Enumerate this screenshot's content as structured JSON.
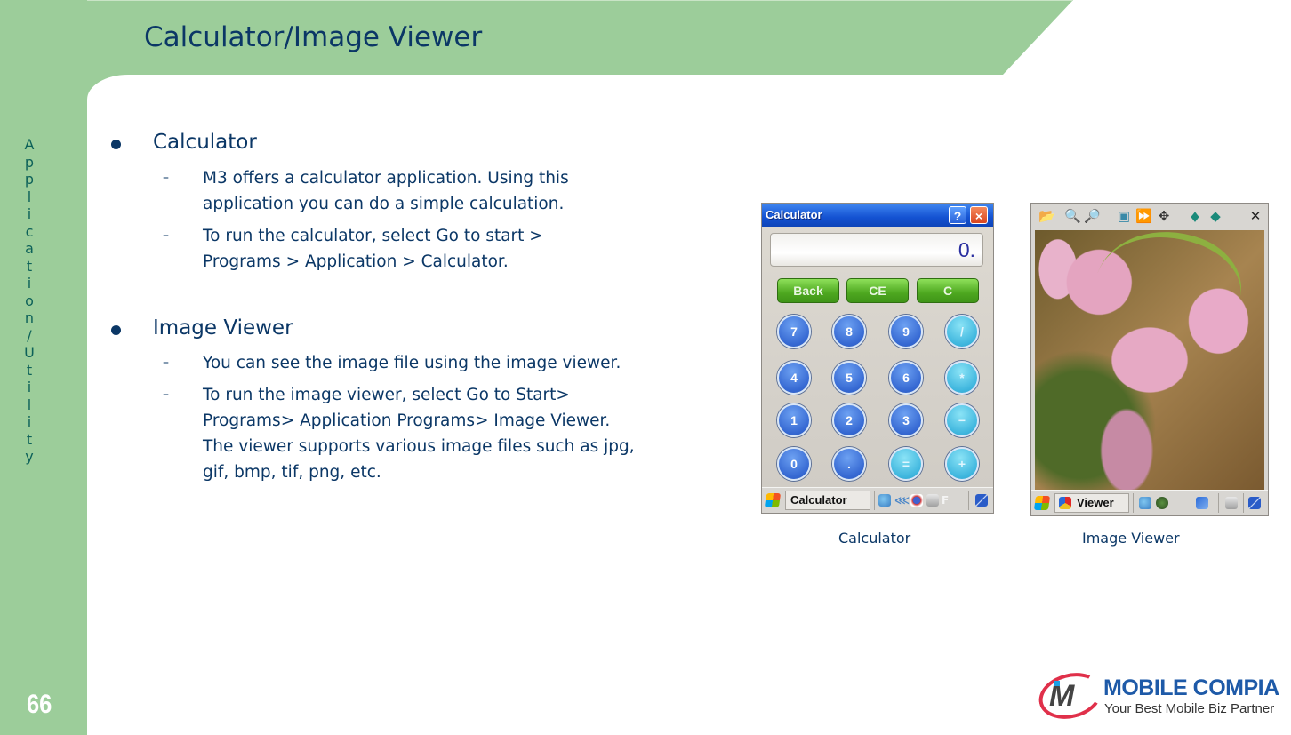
{
  "page": {
    "title": "Calculator/Image Viewer",
    "side_label": "Application/Utility",
    "page_number": "66"
  },
  "sections": [
    {
      "heading": "Calculator",
      "items": [
        [
          "M3 offers a calculator application. Using this",
          "application you can do a simple calculation."
        ],
        [
          "To run the calculator, select Go to start >",
          "Programs > Application > Calculator."
        ]
      ]
    },
    {
      "heading": "Image Viewer",
      "items": [
        [
          "You can see the image file using the image viewer."
        ],
        [
          "To run the image viewer, select Go to Start>",
          "Programs> Application Programs> Image Viewer.",
          "The viewer supports various image files such as jpg,",
          "gif, bmp, tif, png, etc."
        ]
      ]
    }
  ],
  "calculator_screenshot": {
    "window_title": "Calculator",
    "help_button": "?",
    "close_button": "×",
    "display_value": "0.",
    "function_buttons": [
      "Back",
      "CE",
      "C"
    ],
    "keypad": [
      [
        "7",
        "8",
        "9",
        "/"
      ],
      [
        "4",
        "5",
        "6",
        "*"
      ],
      [
        "1",
        "2",
        "3",
        "−"
      ],
      [
        "0",
        ".",
        "=",
        "+"
      ]
    ],
    "taskbar_label": "Calculator",
    "tray_letter": "F",
    "colors": {
      "titlebar": "#1452d2",
      "function_button": "#4ea820",
      "number_key": "#3568d2",
      "operator_key": "#3fb6de"
    }
  },
  "viewer_screenshot": {
    "toolbar_icons": [
      "open-folder-icon",
      "zoom-in-icon",
      "zoom-out-icon",
      "fit-screen-icon",
      "slideshow-icon",
      "rotate-icon",
      "previous-icon",
      "next-icon",
      "close-icon"
    ],
    "toolbar_glyphs": [
      "📂",
      "🔍",
      "🔎",
      "▣",
      "⏩",
      "✥",
      "◆",
      "◆",
      "✕"
    ],
    "taskbar_label": "Viewer",
    "photo_subject": "pink bleeding heart flowers"
  },
  "captions": {
    "calculator": "Calculator",
    "viewer": "Image Viewer"
  },
  "logo": {
    "mark": "M",
    "name": "MOBILE COMPIA",
    "tagline": "Your Best Mobile Biz Partner"
  },
  "colors": {
    "banner_green": "#9ccd9a",
    "heading_navy": "#0b3766",
    "side_label_teal": "#0d6159"
  }
}
